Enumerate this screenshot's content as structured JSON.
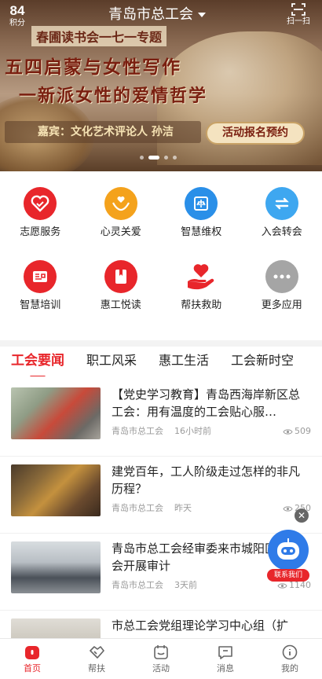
{
  "header": {
    "points_value": "84",
    "points_label": "积分",
    "city": "青岛市总工会",
    "scan_label": "扫一扫"
  },
  "banner": {
    "event_label": "春圃读书会一七一专题",
    "title": "五四启蒙与女性写作",
    "subtitle": "一新派女性的爱情哲学",
    "guest": "嘉宾：文化艺术评论人 孙洁",
    "signup_button": "活动报名预约",
    "slide_count": 4,
    "active_slide": 1
  },
  "quick_actions": [
    {
      "label": "志愿服务",
      "icon": "heart-icon",
      "color": "#e8262b"
    },
    {
      "label": "心灵关爱",
      "icon": "hands-heart-icon",
      "color": "#f4a21c"
    },
    {
      "label": "智慧维权",
      "icon": "scale-icon",
      "color": "#2a8fe8"
    },
    {
      "label": "入会转会",
      "icon": "transfer-icon",
      "color": "#3ea7f0"
    },
    {
      "label": "智慧培训",
      "icon": "training-icon",
      "color": "#e8262b"
    },
    {
      "label": "惠工悦读",
      "icon": "book-icon",
      "color": "#e8262b"
    },
    {
      "label": "帮扶救助",
      "icon": "helping-hand-icon",
      "color": "#e8262b"
    },
    {
      "label": "更多应用",
      "icon": "more-icon",
      "color": "#a5a5a5"
    }
  ],
  "tabs": [
    {
      "label": "工会要闻",
      "active": true
    },
    {
      "label": "职工风采",
      "active": false
    },
    {
      "label": "惠工生活",
      "active": false
    },
    {
      "label": "工会新时空",
      "active": false
    }
  ],
  "news": [
    {
      "title": "【党史学习教育】青岛西海岸新区总工会：用有温度的工会贴心服…",
      "source": "青岛市总工会",
      "time": "16小时前",
      "views": "509"
    },
    {
      "title": "建党百年，工人阶级走过怎样的非凡历程？",
      "source": "青岛市总工会",
      "time": "昨天",
      "views": "250"
    },
    {
      "title": "青岛市总工会经审委来市城阳区总工会开展审计",
      "source": "青岛市总工会",
      "time": "3天前",
      "views": "1140"
    },
    {
      "title": "市总工会党组理论学习中心组（扩",
      "source": "",
      "time": "",
      "views": ""
    }
  ],
  "floating": {
    "contact_label": "联系我们",
    "close_symbol": "✕"
  },
  "bottom_nav": [
    {
      "label": "首页",
      "icon": "home-icon",
      "active": true
    },
    {
      "label": "帮扶",
      "icon": "handshake-icon",
      "active": false
    },
    {
      "label": "活动",
      "icon": "calendar-icon",
      "active": false
    },
    {
      "label": "消息",
      "icon": "message-icon",
      "active": false
    },
    {
      "label": "我的",
      "icon": "profile-icon",
      "active": false
    }
  ],
  "colors": {
    "accent": "#e8262b",
    "muted_text": "#9a9a9a"
  }
}
